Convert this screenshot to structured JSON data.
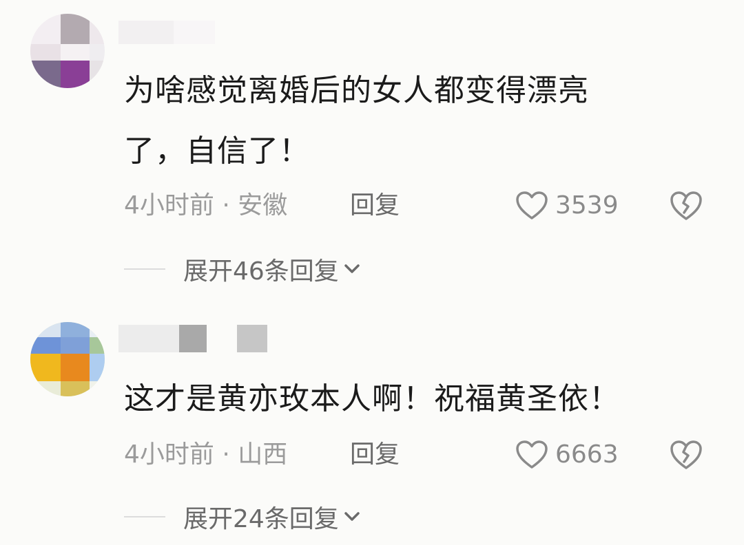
{
  "comments": [
    {
      "text_line1": "为啥感觉离婚后的女人都变得漂亮",
      "text_line2": "了，自信了！",
      "meta_time_location": "4小时前 · 安徽",
      "reply_label": "回复",
      "like_count": "3539",
      "expand_label": "展开46条回复"
    },
    {
      "text_line1": "这才是黄亦玫本人啊！祝福黄圣依！",
      "meta_time_location": "4小时前 · 山西",
      "reply_label": "回复",
      "like_count": "6663",
      "expand_label": "展开24条回复"
    }
  ],
  "icons": {
    "like": "heart-outline-icon",
    "dislike": "broken-heart-icon",
    "expand": "chevron-down-icon"
  },
  "colors": {
    "background": "#fbfbf9",
    "text": "#1b1b1b",
    "meta": "#9b9b9b",
    "action": "#6a6a6a"
  }
}
